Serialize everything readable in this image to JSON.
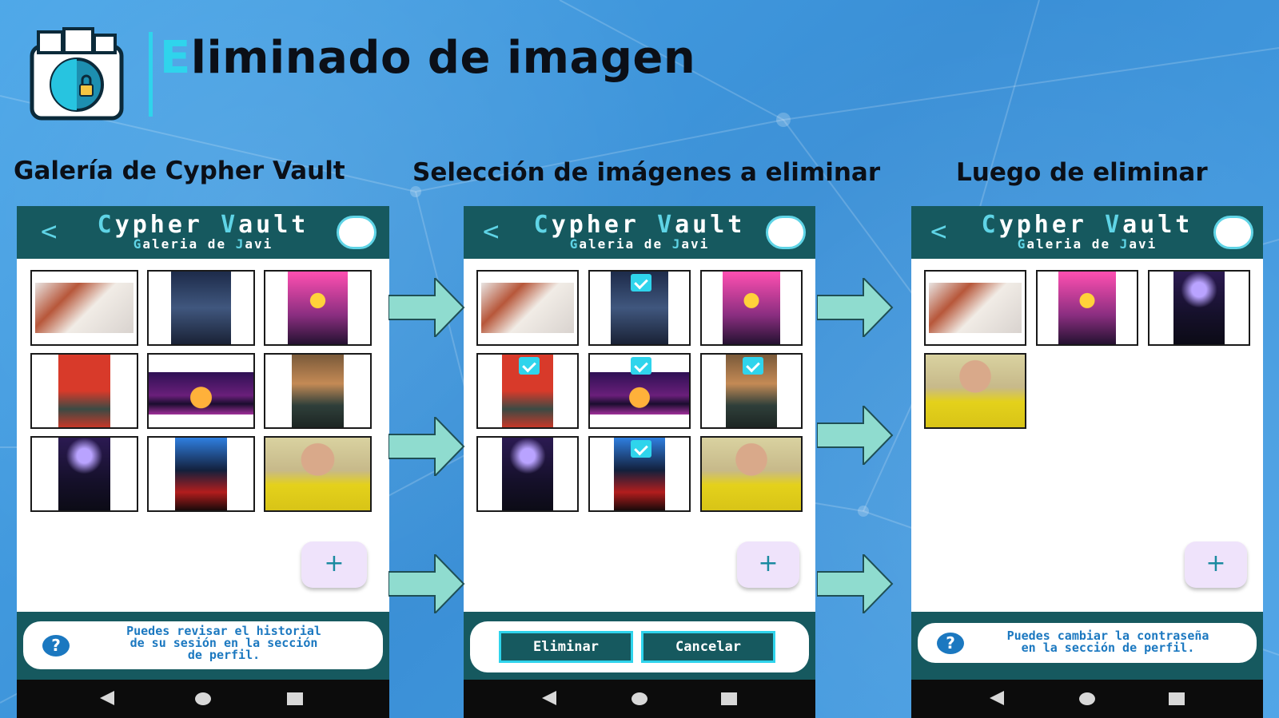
{
  "slide": {
    "title": "Eliminado de imagen",
    "title_first_letter": "E",
    "title_rest": "liminado de imagen",
    "accent_color": "#2fd4ec"
  },
  "columns": [
    {
      "title": "Galería de Cypher Vault"
    },
    {
      "title": "Selección de imágenes a eliminar"
    },
    {
      "title": "Luego de eliminar"
    }
  ],
  "app": {
    "name_part1_initial": "C",
    "name_part1_rest": "ypher ",
    "name_part2_initial": "V",
    "name_part2_rest": "ault",
    "subtitle_p1_initial": "G",
    "subtitle_p1_rest": "aleria de ",
    "subtitle_p2_initial": "J",
    "subtitle_p2_rest": "avi",
    "back_glyph": "<",
    "fab_label": "+",
    "help_glyph": "?",
    "header_color": "#16595f"
  },
  "screens": [
    {
      "id": "gallery",
      "thumbnails": [
        {
          "name": "anime-girl-red-hair",
          "selected": false
        },
        {
          "name": "city-night-sky",
          "selected": false
        },
        {
          "name": "sunset-synthwave-city",
          "selected": false
        },
        {
          "name": "red-dragon-warrior",
          "selected": false
        },
        {
          "name": "retro-sunset-landscape",
          "selected": false
        },
        {
          "name": "anime-boy-jacket",
          "selected": false
        },
        {
          "name": "dark-character-purple",
          "selected": false
        },
        {
          "name": "red-blue-fire-character",
          "selected": false
        },
        {
          "name": "selfie-yellow-hoodie",
          "selected": false
        }
      ],
      "tip_text": "Puedes revisar el historial\nde su sesión en la sección\nde perfil."
    },
    {
      "id": "selection",
      "thumbnails": [
        {
          "name": "anime-girl-red-hair",
          "selected": false
        },
        {
          "name": "city-night-sky",
          "selected": true
        },
        {
          "name": "sunset-synthwave-city",
          "selected": false
        },
        {
          "name": "red-dragon-warrior",
          "selected": true
        },
        {
          "name": "retro-sunset-landscape",
          "selected": true
        },
        {
          "name": "anime-boy-jacket",
          "selected": true
        },
        {
          "name": "dark-character-purple",
          "selected": false
        },
        {
          "name": "red-blue-fire-character",
          "selected": true
        },
        {
          "name": "selfie-yellow-hoodie",
          "selected": false
        }
      ],
      "delete_label": "Eliminar",
      "cancel_label": "Cancelar"
    },
    {
      "id": "after-delete",
      "thumbnails": [
        {
          "name": "anime-girl-red-hair",
          "selected": false
        },
        {
          "name": "sunset-synthwave-city",
          "selected": false
        },
        {
          "name": "dark-character-purple",
          "selected": false
        },
        {
          "name": "selfie-yellow-hoodie",
          "selected": false
        }
      ],
      "tip_text": "Puedes cambiar la contraseña\nen la sección de perfil."
    }
  ]
}
